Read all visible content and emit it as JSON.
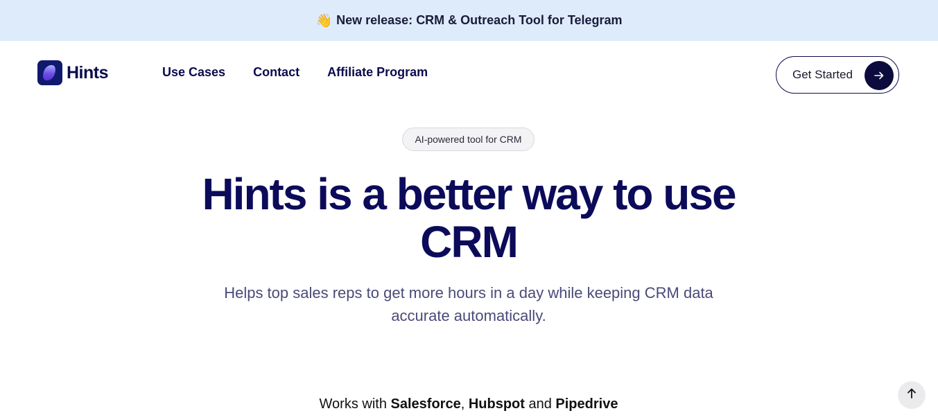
{
  "banner": {
    "icon": "waving-hand-icon",
    "prefix": "New release:",
    "text": "CRM & Outreach Tool for Telegram"
  },
  "logo": {
    "text": "Hints"
  },
  "nav": {
    "items": [
      {
        "label": "Use Cases"
      },
      {
        "label": "Contact"
      },
      {
        "label": "Affiliate Program"
      }
    ]
  },
  "cta": {
    "label": "Get Started",
    "icon": "arrow-right-icon"
  },
  "hero": {
    "badge": "AI-powered tool for CRM",
    "headline": "Hints is a better way to use CRM",
    "subtitle": "Helps top sales reps to get more hours in a day while keeping CRM data accurate automatically."
  },
  "works_with": {
    "prefix": "Works with",
    "item1": "Salesforce",
    "sep": ",",
    "item2": "Hubspot",
    "and": "and",
    "item3": "Pipedrive"
  },
  "scroll_top": {
    "icon": "arrow-up-icon"
  },
  "colors": {
    "banner_bg": "#deebfb",
    "brand_navy": "#0c0b5a",
    "cta_circle": "#0d0b3e"
  }
}
